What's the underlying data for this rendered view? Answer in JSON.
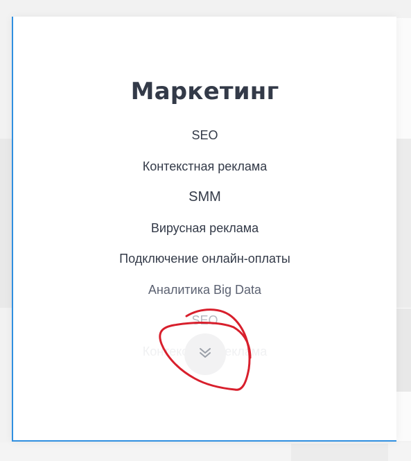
{
  "card": {
    "title": "Маркетинг",
    "items": [
      "SEO",
      "Контекстная реклама",
      "SMM",
      "Вирусная реклама",
      "Подключение онлайн-оплаты",
      "Аналитика Big Data",
      "SEO",
      "Контекстная реклама"
    ],
    "expand_icon": "double-chevron-down-icon"
  },
  "colors": {
    "title": "#333a48",
    "card_border": "#2f8fe0",
    "annotation": "#d81f2c"
  }
}
